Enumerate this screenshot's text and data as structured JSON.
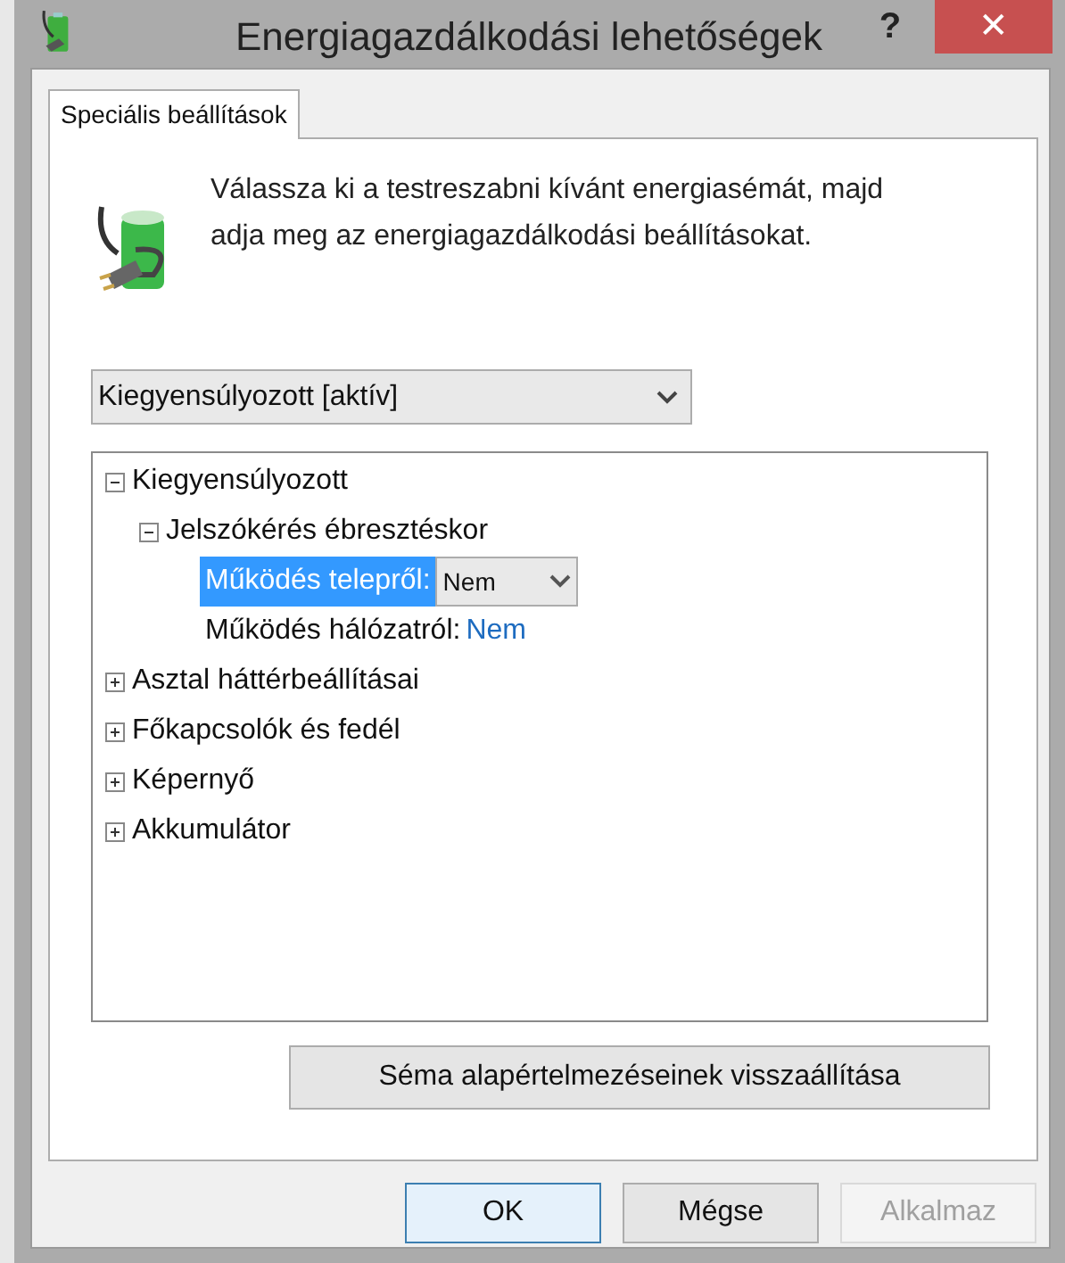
{
  "window": {
    "title": "Energiagazdálkodási lehetőségek",
    "help_button": "?",
    "close_button": "✕"
  },
  "tabs": [
    {
      "label": "Speciális beállítások",
      "selected": true
    }
  ],
  "description": "Válassza ki a testreszabni kívánt energiasémát, majd adja meg az energiagazdálkodási beállításokat.",
  "plan_dropdown": {
    "value": "Kiegyensúlyozott [aktív]"
  },
  "tree": [
    {
      "kind": "group",
      "label": "Kiegyensúlyozott",
      "expanded": true,
      "children": [
        {
          "kind": "group",
          "label": "Jelszókérés ébresztéskor",
          "expanded": true,
          "children": [
            {
              "kind": "setting",
              "label": "Működés telepről:",
              "value": "Nem",
              "selected": true
            },
            {
              "kind": "setting",
              "label": "Működés hálózatról:",
              "value": "Nem",
              "selected": false
            }
          ]
        }
      ]
    },
    {
      "kind": "group",
      "label": "Asztal háttérbeállításai",
      "expanded": false
    },
    {
      "kind": "group",
      "label": "Főkapcsolók és fedél",
      "expanded": false
    },
    {
      "kind": "group",
      "label": "Képernyő",
      "expanded": false
    },
    {
      "kind": "group",
      "label": "Akkumulátor",
      "expanded": false
    }
  ],
  "reset_button": "Séma alapértelmezéseinek visszaállítása",
  "buttons": [
    {
      "label": "OK",
      "default": true,
      "disabled": false
    },
    {
      "label": "Mégse",
      "default": false,
      "disabled": false
    },
    {
      "label": "Alkalmaz",
      "default": false,
      "disabled": true
    }
  ]
}
